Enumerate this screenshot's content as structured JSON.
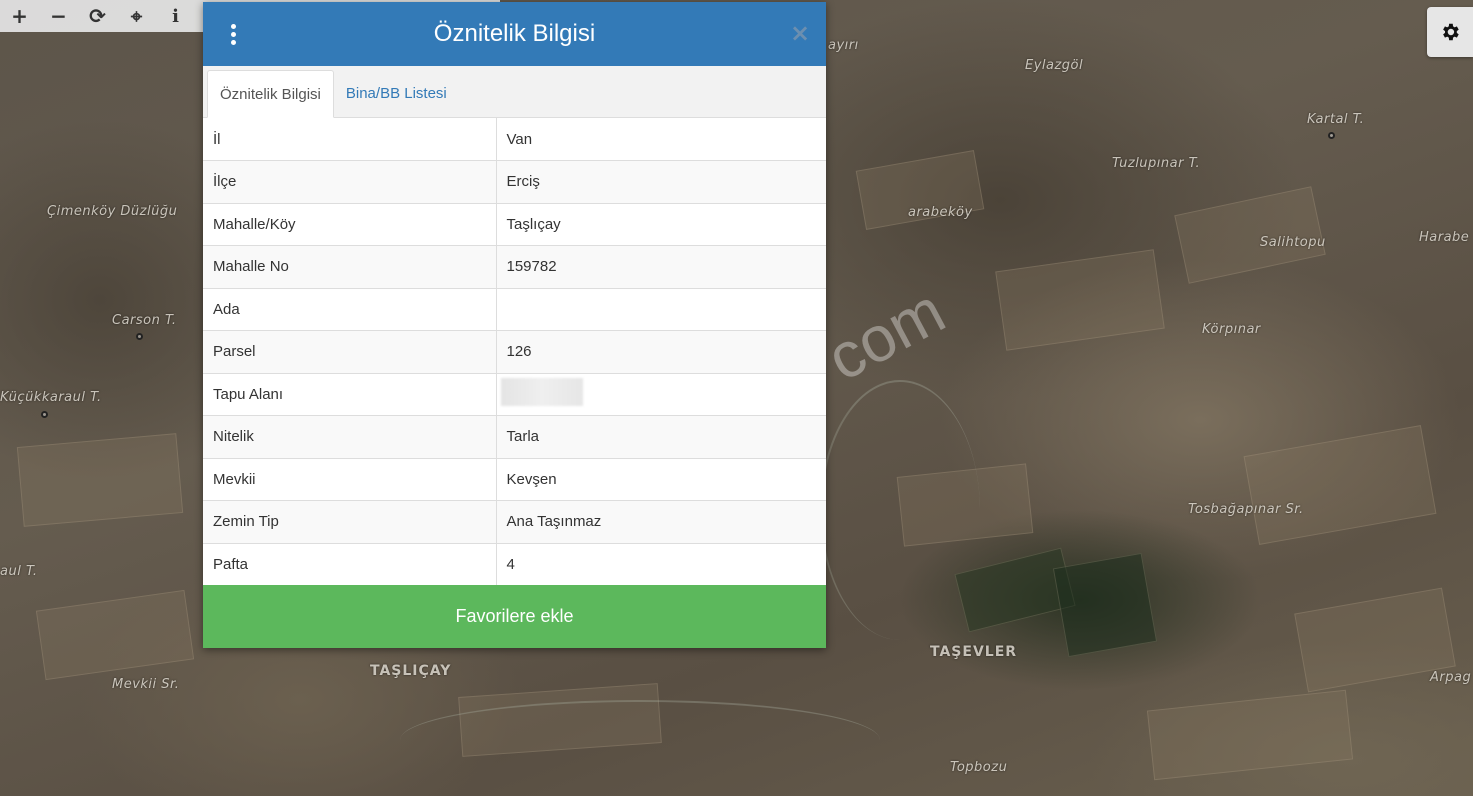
{
  "toolbar": {
    "buttons": [
      {
        "name": "zoom-in-icon",
        "glyph": "+"
      },
      {
        "name": "zoom-out-icon",
        "glyph": "−"
      },
      {
        "name": "refresh-icon",
        "glyph": "⟳"
      },
      {
        "name": "locate-icon",
        "glyph": "⌖"
      },
      {
        "name": "info-icon",
        "glyph": "i"
      }
    ]
  },
  "settings": {
    "icon": "gear-icon"
  },
  "map": {
    "labels": [
      "Eylazgöl",
      "Kartal T.",
      "Tuzlupınar T.",
      "Çimenköy Düzlüğu",
      "arabeköy",
      "Salihtopu",
      "Harabe",
      "Körpınar",
      "Carson T.",
      "Küçükkaraul T.",
      "Tosbağapınar Sr.",
      "aul T.",
      "TAŞEVLER",
      "TAŞLIÇAY",
      "Mevkii Sr.",
      "Arpag",
      "Topbozu",
      "ayırı"
    ],
    "watermark": "com"
  },
  "dialog": {
    "title": "Öznitelik Bilgisi",
    "menu_icon": "more-vertical-icon",
    "close_icon": "close-icon",
    "tabs": [
      {
        "label": "Öznitelik Bilgisi",
        "active": true
      },
      {
        "label": "Bina/BB Listesi",
        "active": false
      }
    ],
    "rows": [
      {
        "key": "İl",
        "value": "Van"
      },
      {
        "key": "İlçe",
        "value": "Erciş"
      },
      {
        "key": "Mahalle/Köy",
        "value": "Taşlıçay"
      },
      {
        "key": "Mahalle No",
        "value": "159782"
      },
      {
        "key": "Ada",
        "value": ""
      },
      {
        "key": "Parsel",
        "value": "126"
      },
      {
        "key": "Tapu Alanı",
        "value": ""
      },
      {
        "key": "Nitelik",
        "value": "Tarla"
      },
      {
        "key": "Mevkii",
        "value": "Kevşen"
      },
      {
        "key": "Zemin Tip",
        "value": "Ana Taşınmaz"
      },
      {
        "key": "Pafta",
        "value": "4"
      }
    ],
    "favorite_button": "Favorilere ekle"
  },
  "colors": {
    "header": "#337ab7",
    "favorite": "#5cb85c",
    "tab_link": "#337ab7"
  }
}
